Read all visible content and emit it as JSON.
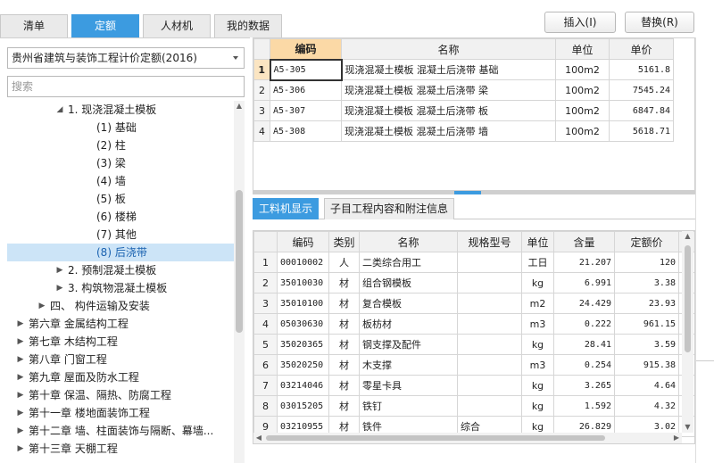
{
  "top_tabs": [
    "清单",
    "定额",
    "人材机",
    "我的数据"
  ],
  "buttons": {
    "insert": "插入(I)",
    "replace": "替换(R)"
  },
  "left": {
    "quota_select": "贵州省建筑与装饰工程计价定额(2016)",
    "search_placeholder": "搜索",
    "tree": [
      {
        "label": "1. 现浇混凝土模板",
        "arrow": "expanded"
      },
      {
        "label": "(1) 基础",
        "arrow": ""
      },
      {
        "label": "(2) 柱",
        "arrow": ""
      },
      {
        "label": "(3) 梁",
        "arrow": ""
      },
      {
        "label": "(4) 墙",
        "arrow": ""
      },
      {
        "label": "(5) 板",
        "arrow": ""
      },
      {
        "label": "(6) 楼梯",
        "arrow": ""
      },
      {
        "label": "(7) 其他",
        "arrow": ""
      },
      {
        "label": "(8) 后浇带",
        "arrow": "",
        "selected": true
      },
      {
        "label": "2. 预制混凝土模板",
        "arrow": "collapsed"
      },
      {
        "label": "3. 构筑物混凝土模板",
        "arrow": "collapsed"
      },
      {
        "label": "四、 构件运输及安装",
        "arrow": "collapsed"
      },
      {
        "label": "第六章 金属结构工程",
        "arrow": "collapsed"
      },
      {
        "label": "第七章 木结构工程",
        "arrow": "collapsed"
      },
      {
        "label": "第八章 门窗工程",
        "arrow": "collapsed"
      },
      {
        "label": "第九章 屋面及防水工程",
        "arrow": "collapsed"
      },
      {
        "label": "第十章 保温、隔热、防腐工程",
        "arrow": "collapsed"
      },
      {
        "label": "第十一章 楼地面装饰工程",
        "arrow": "collapsed"
      },
      {
        "label": "第十二章 墙、柱面装饰与隔断、幕墙...",
        "arrow": "collapsed"
      },
      {
        "label": "第十三章 天棚工程",
        "arrow": "collapsed"
      }
    ]
  },
  "quota_table": {
    "headers": [
      "编码",
      "名称",
      "单位",
      "单价"
    ],
    "rows": [
      {
        "idx": "1",
        "code": "A5-305",
        "name": "现浇混凝土模板 混凝土后浇带 基础",
        "unit": "100m2",
        "price": "5161.8",
        "active": true
      },
      {
        "idx": "2",
        "code": "A5-306",
        "name": "现浇混凝土模板 混凝土后浇带 梁",
        "unit": "100m2",
        "price": "7545.24"
      },
      {
        "idx": "3",
        "code": "A5-307",
        "name": "现浇混凝土模板 混凝土后浇带 板",
        "unit": "100m2",
        "price": "6847.84"
      },
      {
        "idx": "4",
        "code": "A5-308",
        "name": "现浇混凝土模板 混凝土后浇带 墙",
        "unit": "100m2",
        "price": "5618.71"
      }
    ]
  },
  "bottom_tabs": [
    "工料机显示",
    "子目工程内容和附注信息"
  ],
  "material_table": {
    "headers": [
      "编码",
      "类别",
      "名称",
      "规格型号",
      "单位",
      "含量",
      "定额价"
    ],
    "rows": [
      {
        "idx": "1",
        "code": "00010002",
        "type": "人",
        "name": "二类综合用工",
        "spec": "",
        "unit": "工日",
        "qty": "21.207",
        "price": "120"
      },
      {
        "idx": "2",
        "code": "35010030",
        "type": "材",
        "name": "组合钢模板",
        "spec": "",
        "unit": "kg",
        "qty": "6.991",
        "price": "3.38"
      },
      {
        "idx": "3",
        "code": "35010100",
        "type": "材",
        "name": "复合模板",
        "spec": "",
        "unit": "m2",
        "qty": "24.429",
        "price": "23.93"
      },
      {
        "idx": "4",
        "code": "05030630",
        "type": "材",
        "name": "板枋材",
        "spec": "",
        "unit": "m3",
        "qty": "0.222",
        "price": "961.15"
      },
      {
        "idx": "5",
        "code": "35020365",
        "type": "材",
        "name": "钢支撑及配件",
        "spec": "",
        "unit": "kg",
        "qty": "28.41",
        "price": "3.59"
      },
      {
        "idx": "6",
        "code": "35020250",
        "type": "材",
        "name": "木支撑",
        "spec": "",
        "unit": "m3",
        "qty": "0.254",
        "price": "915.38"
      },
      {
        "idx": "7",
        "code": "03214046",
        "type": "材",
        "name": "零星卡具",
        "spec": "",
        "unit": "kg",
        "qty": "3.265",
        "price": "4.64"
      },
      {
        "idx": "8",
        "code": "03015205",
        "type": "材",
        "name": "铁钉",
        "spec": "",
        "unit": "kg",
        "qty": "1.592",
        "price": "4.32"
      },
      {
        "idx": "9",
        "code": "03210955",
        "type": "材",
        "name": "铁件",
        "spec": "综合",
        "unit": "kg",
        "qty": "26.829",
        "price": "3.02"
      }
    ]
  }
}
